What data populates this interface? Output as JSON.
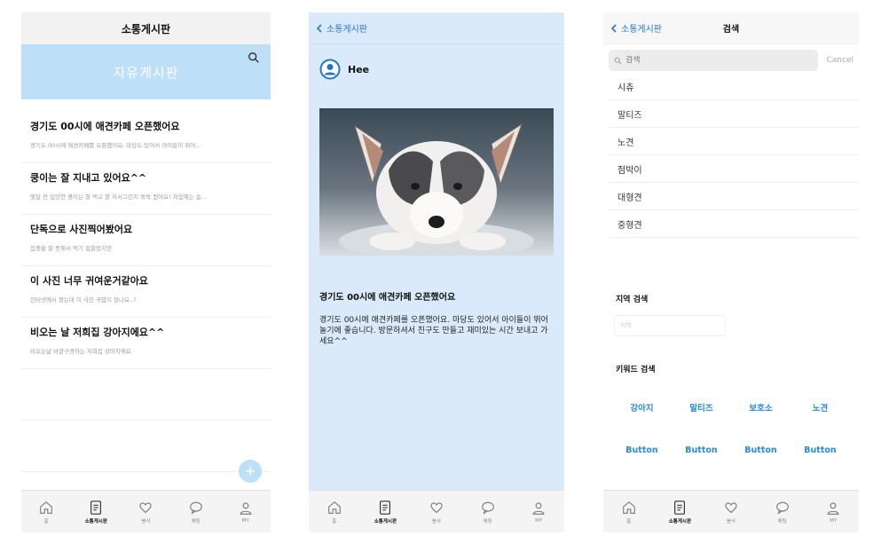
{
  "board": {
    "header_title": "소통게시판",
    "hero_title": "자유게시판",
    "posts": [
      {
        "title": "경기도 00시에 애견카페 오픈했어요",
        "excerpt": "경기도 00시에 애견카페를 오픈했어요. 마당도 있어서 아이들이 뛰어..."
      },
      {
        "title": "쿵이는 잘 지내고 있어요^^",
        "excerpt": "몇달 전 입양한 쿵이는 잘 먹고 잘 자서그런지 쑥쑥 컸어요! 처음에는 숨..."
      },
      {
        "title": "단독으로 사진찍어봤어요",
        "excerpt": "집중을 잘 못해서 찍기 힘들었지만"
      },
      {
        "title": "이 사진 너무 귀여운거같아요",
        "excerpt": "인터넷에서 봤는데 이 사진 귀엽지 않나요..?"
      },
      {
        "title": "비오는 날 저희집 강아지에요^^",
        "excerpt": "비오는날 바깥구경하는 저희집 강아지에요"
      }
    ],
    "fab_label": "+"
  },
  "tabs": [
    {
      "label": "홈",
      "icon": "home-icon"
    },
    {
      "label": "소통게시판",
      "icon": "board-icon"
    },
    {
      "label": "봉사",
      "icon": "heart-icon"
    },
    {
      "label": "채팅",
      "icon": "chat-icon"
    },
    {
      "label": "MY",
      "icon": "person-icon"
    }
  ],
  "detail": {
    "back_label": "소통게시판",
    "author": "Hee",
    "title": "경기도 00시에 애견카페 오픈했어요",
    "body": "경기도 00시에 애견카페를 오픈했어요. 마당도 있어서 아이들이 뛰어 놀기에 좋습니다. 방문하셔서 친구도 만들고 재미있는 시간 보내고 가세요^^"
  },
  "search": {
    "back_label": "소통게시판",
    "title": "검색",
    "placeholder": "검색",
    "cancel": "Cancel",
    "results": [
      "시츄",
      "말티즈",
      "노견",
      "점박이",
      "대형견",
      "중형견"
    ],
    "region_title": "지역 검색",
    "region_placeholder": "지역",
    "keyword_title": "키워드 검색",
    "keywords": [
      "강아지",
      "말티즈",
      "보호소",
      "노견"
    ],
    "buttons": [
      "Button",
      "Button",
      "Button",
      "Button"
    ]
  },
  "colors": {
    "accent": "#2a8ae0",
    "hero_bg": "#bde0f8",
    "detail_bg": "#dbeafa"
  }
}
